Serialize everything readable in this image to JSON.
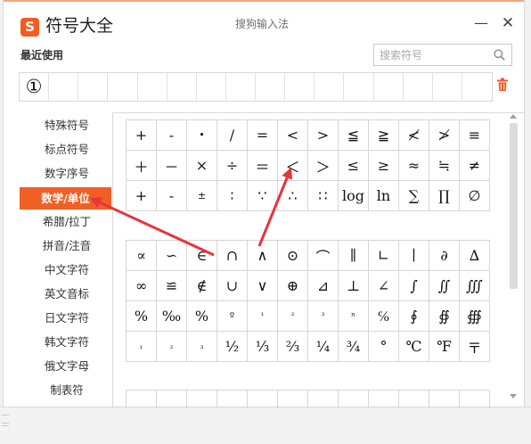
{
  "header": {
    "logo_glyph": "S",
    "app_title": "符号大全",
    "center_title": "搜狗输入法",
    "minimize_glyph": "—",
    "close_glyph": "✕"
  },
  "recent": {
    "label": "最近使用",
    "symbols": [
      "①",
      "",
      "",
      "",
      "",
      "",
      "",
      "",
      "",
      "",
      "",
      "",
      "",
      "",
      "",
      ""
    ]
  },
  "search": {
    "placeholder": "搜索符号",
    "value": ""
  },
  "sidebar": {
    "items": [
      {
        "label": "特殊符号"
      },
      {
        "label": "标点符号"
      },
      {
        "label": "数字序号"
      },
      {
        "label": "数学/单位",
        "active": true
      },
      {
        "label": "希腊/拉丁"
      },
      {
        "label": "拼音/注音"
      },
      {
        "label": "中文字符"
      },
      {
        "label": "英文音标"
      },
      {
        "label": "日文字符"
      },
      {
        "label": "韩文字符"
      },
      {
        "label": "俄文字母"
      },
      {
        "label": "制表符"
      }
    ]
  },
  "grids": [
    {
      "rows": [
        [
          "+",
          "-",
          "•",
          "/",
          "=",
          "<",
          ">",
          "≦",
          "≧",
          "≮",
          "≯",
          "≡"
        ],
        [
          "＋",
          "－",
          "×",
          "÷",
          "＝",
          "＜",
          "＞",
          "≤",
          "≥",
          "≈",
          "≒",
          "≠"
        ],
        [
          "+",
          "-",
          "±",
          "∶",
          "∵",
          "∴",
          "∷",
          "log",
          "ln",
          "∑",
          "∏",
          "∅"
        ]
      ]
    },
    {
      "rows": [
        [
          "∝",
          "∽",
          "∈",
          "∩",
          "∧",
          "⊙",
          "⌒",
          "∥",
          "∟",
          "∣",
          "∂",
          "∆"
        ],
        [
          "∞",
          "≌",
          "∉",
          "∪",
          "∨",
          "⊕",
          "⊿",
          "⊥",
          "∠",
          "∫",
          "∬",
          "∭"
        ],
        [
          "%",
          "‰",
          "%",
          "º",
          "¹",
          "²",
          "³",
          "ⁿ",
          "℅",
          "∮",
          "∯",
          "∰"
        ],
        [
          "₁",
          "₂",
          "₃",
          "½",
          "⅓",
          "⅔",
          "¼",
          "¾",
          "°",
          "℃",
          "℉",
          "〒"
        ]
      ]
    },
    {
      "rows": [
        [
          "",
          "",
          "",
          "",
          "",
          "",
          "",
          "",
          "",
          "",
          "",
          ""
        ]
      ]
    }
  ],
  "accent_color": "#f05f24",
  "arrow_color": "#e8343a",
  "icons": {
    "search": "search-icon",
    "trash": "trash-icon",
    "minimize": "minimize-icon",
    "close": "close-icon"
  }
}
